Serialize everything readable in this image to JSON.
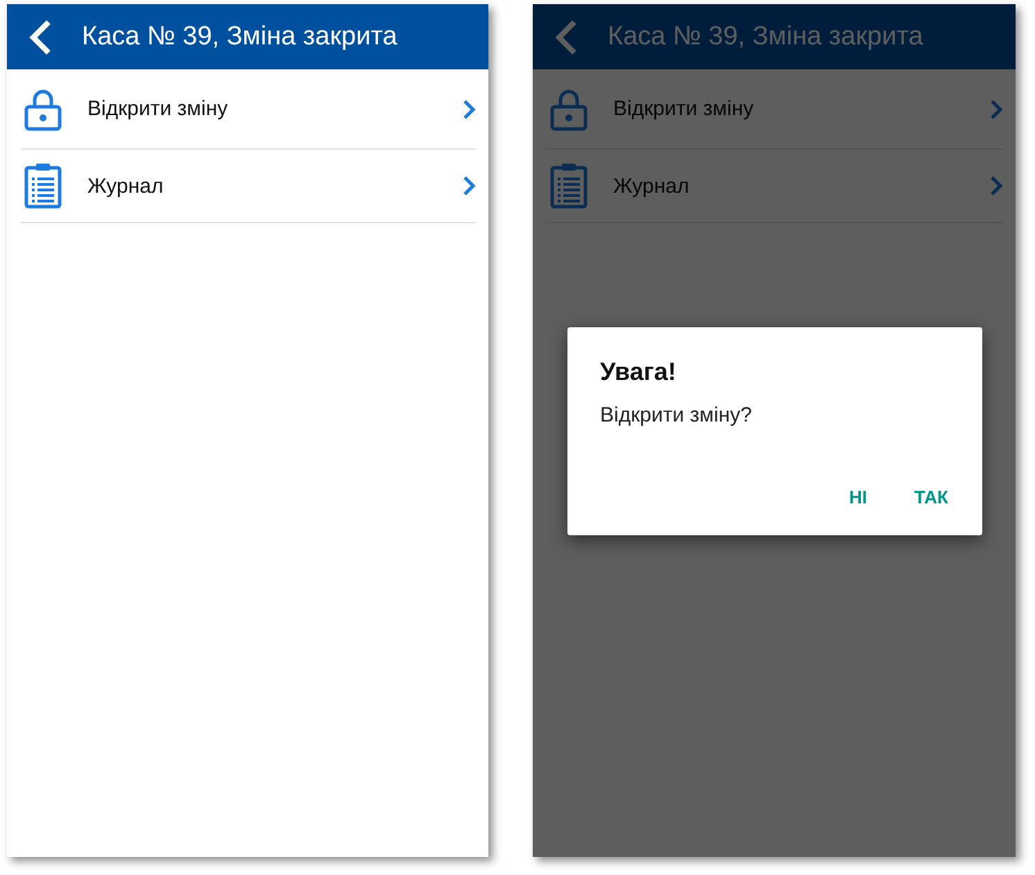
{
  "screens": [
    {
      "title": "Каса № 39, Зміна закрита",
      "items": [
        {
          "kind": "lock",
          "label": "Відкрити зміну"
        },
        {
          "kind": "clipboard",
          "label": "Журнал"
        }
      ]
    },
    {
      "title": "Каса № 39, Зміна закрита",
      "items": [
        {
          "kind": "lock",
          "label": "Відкрити зміну"
        },
        {
          "kind": "clipboard",
          "label": "Журнал"
        }
      ],
      "dialog": {
        "title": "Увага!",
        "message": "Відкрити зміну?",
        "buttons": [
          "НІ",
          "ТАК"
        ]
      }
    }
  ]
}
